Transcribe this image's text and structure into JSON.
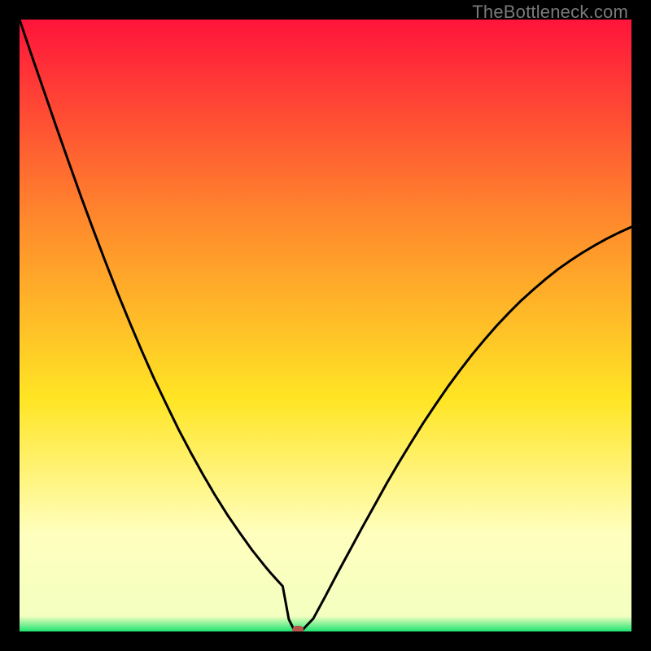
{
  "watermark": "TheBottleneck.com",
  "colors": {
    "curve": "#000000",
    "marker": "#b5564e",
    "top": "#ff143b",
    "mid_upper": "#ff8a2c",
    "mid": "#ffe524",
    "pale": "#ffffbe",
    "green": "#1ee471"
  },
  "chart_data": {
    "type": "line",
    "title": "",
    "xlabel": "",
    "ylabel": "",
    "xlim": [
      0,
      100
    ],
    "ylim": [
      0,
      100
    ],
    "x": [
      0,
      2,
      4,
      6,
      8,
      10,
      12,
      14,
      16,
      18,
      20,
      22,
      24,
      26,
      28,
      30,
      32,
      34,
      36,
      38,
      40,
      41,
      42,
      43,
      44,
      45,
      46,
      48,
      50,
      52,
      54,
      56,
      58,
      60,
      62,
      64,
      66,
      68,
      70,
      72,
      74,
      76,
      78,
      80,
      82,
      84,
      86,
      88,
      90,
      92,
      94,
      96,
      98,
      100
    ],
    "values": [
      100,
      94.1,
      88.3,
      82.5,
      76.8,
      71.2,
      65.8,
      60.5,
      55.4,
      50.5,
      45.8,
      41.3,
      37.1,
      33.0,
      29.2,
      25.6,
      22.2,
      19.0,
      16.1,
      13.3,
      10.8,
      9.6,
      8.5,
      7.4,
      2.0,
      0.0,
      0.0,
      2.1,
      5.8,
      9.6,
      13.3,
      17.0,
      20.6,
      24.2,
      27.6,
      30.9,
      34.1,
      37.1,
      40.0,
      42.7,
      45.3,
      47.7,
      50.0,
      52.1,
      54.1,
      55.9,
      57.6,
      59.2,
      60.6,
      61.9,
      63.1,
      64.2,
      65.2,
      66.1
    ],
    "marker": {
      "x": 45.5,
      "y": 0.0
    },
    "annotations": []
  }
}
